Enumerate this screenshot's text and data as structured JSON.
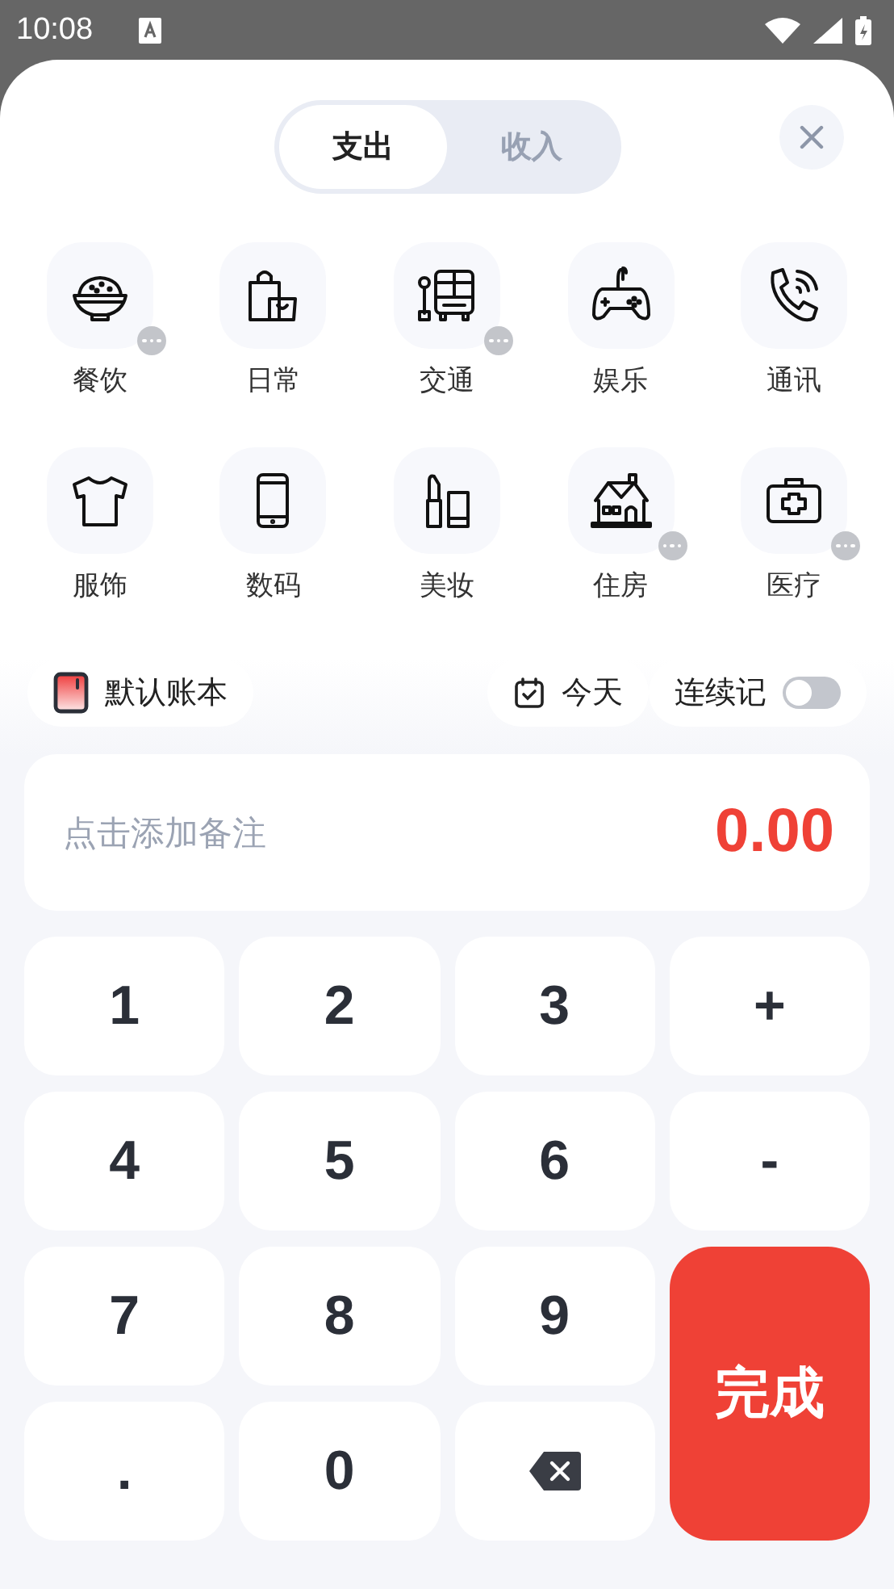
{
  "status_bar": {
    "time": "10:08"
  },
  "tabs": [
    {
      "label": "支出",
      "selected": true
    },
    {
      "label": "收入",
      "selected": false
    }
  ],
  "categories": [
    {
      "label": "餐饮",
      "has_more": true
    },
    {
      "label": "日常",
      "has_more": false
    },
    {
      "label": "交通",
      "has_more": true
    },
    {
      "label": "娱乐",
      "has_more": false
    },
    {
      "label": "通讯",
      "has_more": false
    },
    {
      "label": "服饰",
      "has_more": false
    },
    {
      "label": "数码",
      "has_more": false
    },
    {
      "label": "美妆",
      "has_more": false
    },
    {
      "label": "住房",
      "has_more": true
    },
    {
      "label": "医疗",
      "has_more": true
    }
  ],
  "options": {
    "book": "默认账本",
    "date": "今天",
    "continuous": {
      "label": "连续记",
      "on": false
    }
  },
  "note": {
    "placeholder": "点击添加备注",
    "amount": "0.00"
  },
  "keys": [
    {
      "kind": "digit",
      "label": "1"
    },
    {
      "kind": "digit",
      "label": "2"
    },
    {
      "kind": "digit",
      "label": "3"
    },
    {
      "kind": "op",
      "label": "+"
    },
    {
      "kind": "digit",
      "label": "4"
    },
    {
      "kind": "digit",
      "label": "5"
    },
    {
      "kind": "digit",
      "label": "6"
    },
    {
      "kind": "op",
      "label": "-"
    },
    {
      "kind": "digit",
      "label": "7"
    },
    {
      "kind": "digit",
      "label": "8"
    },
    {
      "kind": "digit",
      "label": "9"
    },
    {
      "kind": "done",
      "label": "完成"
    },
    {
      "kind": "digit",
      "label": "."
    },
    {
      "kind": "digit",
      "label": "0"
    },
    {
      "kind": "delete"
    }
  ]
}
